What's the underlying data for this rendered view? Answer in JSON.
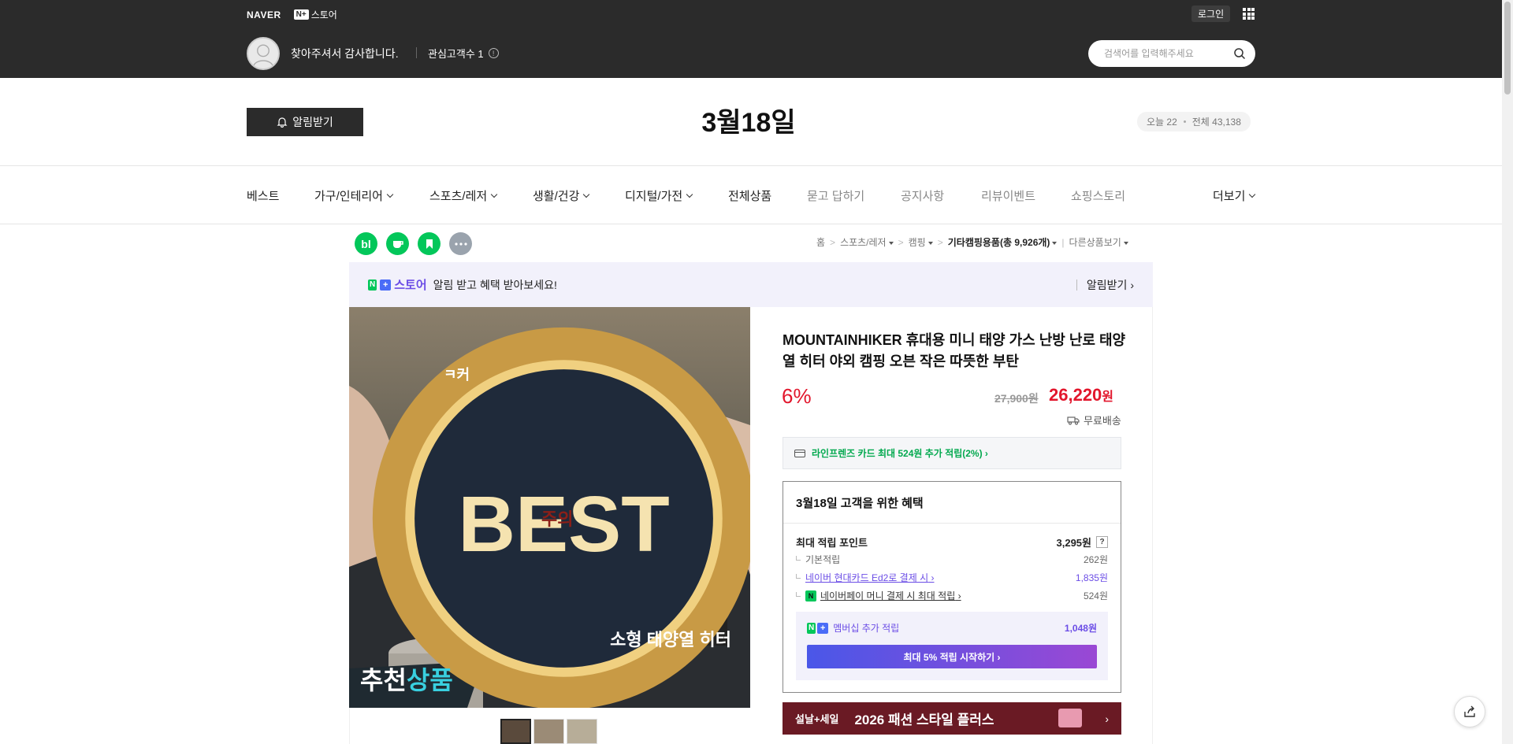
{
  "header": {
    "naver_logo": "NAVER",
    "nplus_badge": "N+",
    "nplus_store": "스토어",
    "login": "로그인",
    "welcome": "찾아주셔서 감사합니다.",
    "fans": "관심고객수 1",
    "info": "!",
    "search_placeholder": "검색어를 입력해주세요"
  },
  "store_bar": {
    "alarm_button": "알림받기",
    "title": "3월18일",
    "today_label": "오늘 22",
    "total_label": "전체 43,138"
  },
  "nav": {
    "items": [
      {
        "label": "베스트"
      },
      {
        "label": "가구/인테리어"
      },
      {
        "label": "스포츠/레저"
      },
      {
        "label": "생활/건강"
      },
      {
        "label": "디지털/가전"
      },
      {
        "label": "전체상품"
      },
      {
        "label": "묻고 답하기"
      },
      {
        "label": "공지사항"
      },
      {
        "label": "리뷰이벤트"
      },
      {
        "label": "쇼핑스토리"
      },
      {
        "label": "더보기"
      }
    ]
  },
  "social": {
    "blog": "bl"
  },
  "breadcrumb": {
    "home": "홈",
    "level1": "스포츠/레저",
    "level2": "캠핑",
    "level3": "기타캠핑용품",
    "count": "(총 9,926개)",
    "other": "다른상품보기",
    "sep": ">"
  },
  "promo": {
    "store": "스토어",
    "text": "알림 받고 혜택 받아보세요!",
    "alarm": "알림받기 ›"
  },
  "image": {
    "badge": "BEST",
    "warning": "주의",
    "brand_partial": "ㅋ커",
    "caption": "소형 태양열 히터",
    "reco_1": "추천",
    "reco_2": "상품"
  },
  "product": {
    "title": "MOUNTAINHIKER 휴대용 미니 태양 가스 난방 난로 태양열 히터 야외 캠핑 오븐 작은 따뜻한 부탄",
    "discount": "6%",
    "original_price": "27,900원",
    "sale_price": "26,220",
    "won": "원",
    "shipping": "무료배송",
    "card_benefit": "라인프렌즈 카드 최대 524원 추가 적립(2%) ›"
  },
  "benefit": {
    "title": "3월18일 고객을 위한 혜택",
    "max_point_label": "최대 적립 포인트",
    "max_point_value": "3,295원",
    "help": "?",
    "basic_label": "기본적립",
    "basic_value": "262원",
    "card_label": "네이버 현대카드 Ed2로 결제 시",
    "card_value": "1,835원",
    "npay_label": "네이버페이 머니 결제 시 최대 적립",
    "npay_value": "524원",
    "npay_icon": "N",
    "member_label": "멤버십 추가 적립",
    "member_value": "1,048원",
    "member_button": "최대 5% 적립 시작하기 ›"
  },
  "fashion_banner": {
    "tag": "설날+세일",
    "text": "2026 패션 스타일 플러스",
    "arrow": "›"
  },
  "colors": {
    "accent_red": "#e2162c",
    "naver_green": "#03c75a",
    "purple": "#6b4de6",
    "dark_bar": "#2b2b2b"
  }
}
